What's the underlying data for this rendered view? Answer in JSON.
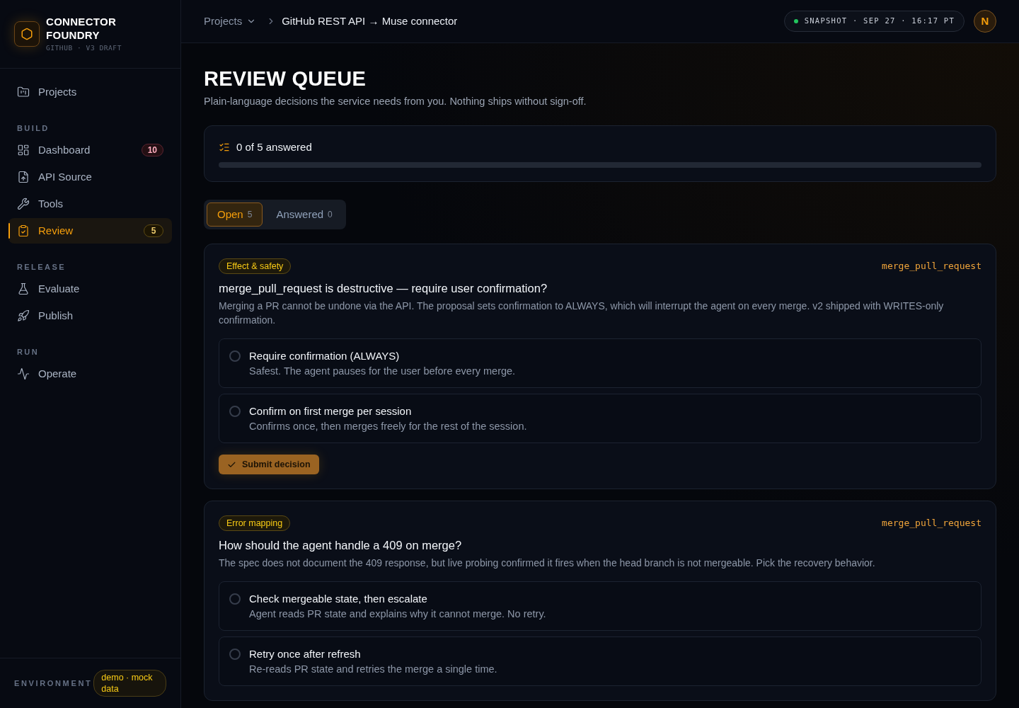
{
  "brand": {
    "name": "CONNECTOR FOUNDRY",
    "subtitle": "GITHUB · V3 DRAFT"
  },
  "sidebar": {
    "sections": [
      {
        "items": [
          {
            "label": "Projects",
            "selected": false
          }
        ]
      },
      {
        "heading": "BUILD",
        "items": [
          {
            "label": "Dashboard",
            "selected": false,
            "badge": {
              "text": "10",
              "color": "#5a2430"
            }
          },
          {
            "label": "API Source",
            "selected": false
          },
          {
            "label": "Tools",
            "selected": false
          },
          {
            "label": "Review",
            "selected": true,
            "badge": {
              "text": "5",
              "color": "#5c4a14"
            }
          }
        ]
      },
      {
        "heading": "RELEASE",
        "items": [
          {
            "label": "Evaluate",
            "selected": false
          },
          {
            "label": "Publish",
            "selected": false
          }
        ]
      },
      {
        "heading": "RUN",
        "items": [
          {
            "label": "Operate",
            "selected": false
          }
        ]
      }
    ],
    "footer": {
      "label": "ENVIRONMENT",
      "value": "demo · mock data"
    }
  },
  "header": {
    "breadcrumb": {
      "parent": "Projects",
      "current": "GitHub REST API → Muse connector"
    },
    "snapshot": "SNAPSHOT · SEP 27 · 16:17 PT",
    "avatar": "N"
  },
  "page": {
    "title": "REVIEW QUEUE",
    "subtitle": "Plain-language decisions the service needs from you. Nothing ships without sign-off."
  },
  "progress": {
    "label": "0 of 5 answered"
  },
  "tabs": [
    {
      "label": "Open",
      "count": "5",
      "selected": true
    },
    {
      "label": "Answered",
      "count": "0",
      "selected": false
    }
  ],
  "questions": [
    {
      "tag": "Effect & safety",
      "tool": "merge_pull_request",
      "title": "merge_pull_request is destructive — require user confirmation?",
      "description": "Merging a PR cannot be undone via the API. The proposal sets confirmation to ALWAYS, which will interrupt the agent on every merge. v2 shipped with WRITES-only confirmation.",
      "options": [
        {
          "title": "Require confirmation (ALWAYS)",
          "description": "Safest. The agent pauses for the user before every merge.",
          "selected": false
        },
        {
          "title": "Confirm on first merge per session",
          "description": "Confirms once, then merges freely for the rest of the session.",
          "selected": false
        }
      ],
      "submit": "Submit decision"
    },
    {
      "tag": "Error mapping",
      "tool": "merge_pull_request",
      "title": "How should the agent handle a 409 on merge?",
      "description": "The spec does not document the 409 response, but live probing confirmed it fires when the head branch is not mergeable. Pick the recovery behavior.",
      "options": [
        {
          "title": "Check mergeable state, then escalate",
          "description": "Agent reads PR state and explains why it cannot merge. No retry.",
          "selected": false
        },
        {
          "title": "Retry once after refresh",
          "description": "Re-reads PR state and retries the merge a single time.",
          "selected": false
        }
      ]
    }
  ]
}
